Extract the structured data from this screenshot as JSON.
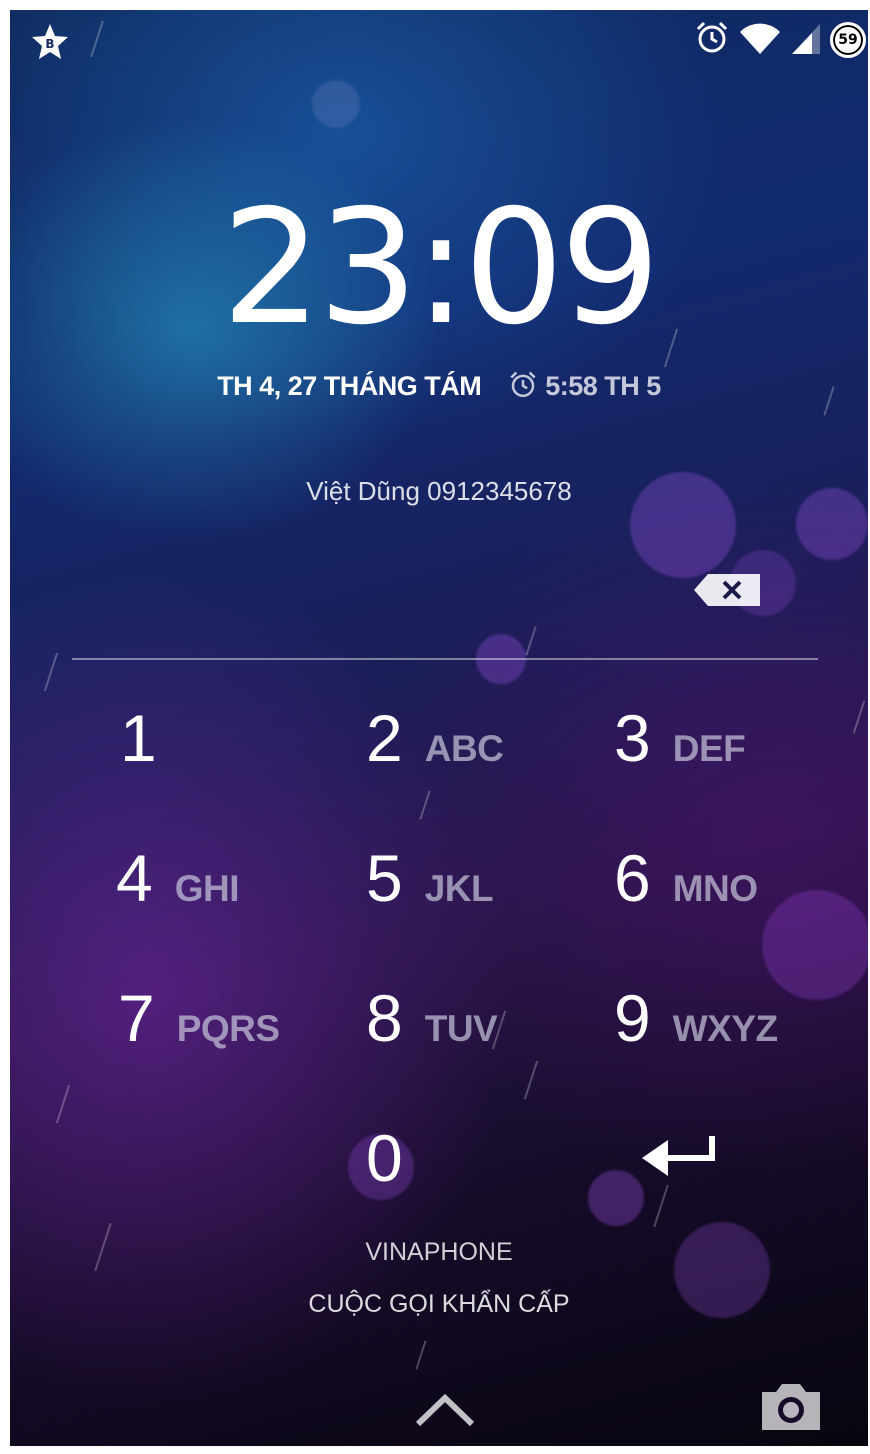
{
  "status_bar": {
    "left_icon": "star-app-icon",
    "icons": [
      "alarm-icon",
      "wifi-icon",
      "signal-icon"
    ],
    "battery_level": "59"
  },
  "clock": {
    "time": "23:09",
    "date": "TH 4, 27 THÁNG TÁM",
    "next_alarm": "5:58 TH 5"
  },
  "owner_info": "Việt Dũng 0912345678",
  "keypad": {
    "keys": [
      {
        "digit": "1",
        "letters": ""
      },
      {
        "digit": "2",
        "letters": "ABC"
      },
      {
        "digit": "3",
        "letters": "DEF"
      },
      {
        "digit": "4",
        "letters": "GHI"
      },
      {
        "digit": "5",
        "letters": "JKL"
      },
      {
        "digit": "6",
        "letters": "MNO"
      },
      {
        "digit": "7",
        "letters": "PQRS"
      },
      {
        "digit": "8",
        "letters": "TUV"
      },
      {
        "digit": "9",
        "letters": "WXYZ"
      },
      {
        "digit": "0",
        "letters": ""
      }
    ],
    "backspace_icon": "backspace-icon",
    "enter_icon": "enter-arrow-icon"
  },
  "footer": {
    "carrier": "VINAPHONE",
    "emergency_call": "CUỘC GỌI KHẨN CẤP"
  },
  "colors": {
    "text": "#ffffff",
    "muted_letters": "#c8c8dc",
    "bokeh": "#9650dc"
  }
}
